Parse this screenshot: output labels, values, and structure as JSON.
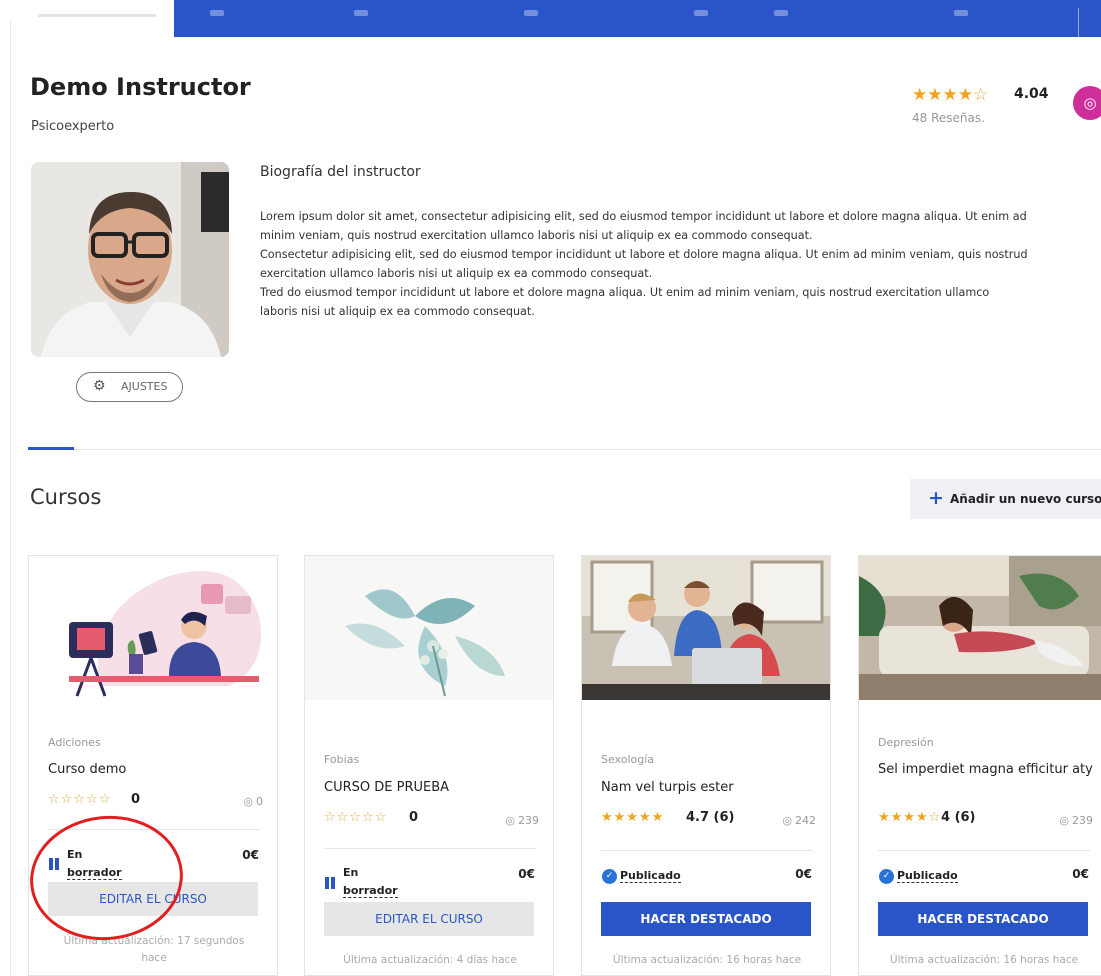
{
  "instructor": {
    "name": "Demo Instructor",
    "role": "Psicoexperto",
    "rating": "4.04",
    "reviews": "48 Reseñas.",
    "settings_label": "AJUSTES",
    "social_icon": "instagram-icon"
  },
  "bio": {
    "title": "Biografía del instructor",
    "lines": [
      "Lorem ipsum dolor sit amet, consectetur adipisicing elit, sed do eiusmod tempor incididunt ut labore et dolore magna aliqua. Ut enim ad",
      "minim veniam, quis nostrud exercitation ullamco laboris nisi ut aliquip ex ea commodo consequat.",
      "Consectetur adipisicing elit, sed do eiusmod tempor incididunt ut labore et dolore magna aliqua. Ut enim ad minim veniam, quis nostrud",
      "exercitation ullamco laboris nisi ut aliquip ex ea commodo consequat.",
      "Tred do eiusmod tempor incididunt ut labore et dolore magna aliqua. Ut enim ad minim veniam, quis nostrud exercitation ullamco",
      "laboris nisi ut aliquip ex ea commodo consequat."
    ]
  },
  "courses": {
    "title": "Cursos",
    "add_label": "Añadir un nuevo curso",
    "items": [
      {
        "category": "Adiciones",
        "title": "Curso demo",
        "stars": 0,
        "score": "0",
        "views": "0",
        "status_l1": "En",
        "status_l2": "borrador",
        "price": "0€",
        "action": "EDITAR EL CURSO",
        "updated_l1": "Última actualización: 17 segundos",
        "updated_l2": "hace"
      },
      {
        "category": "Fobias",
        "title": "CURSO DE PRUEBA",
        "stars": 0,
        "score": "0",
        "views": "239",
        "status_l1": "En",
        "status_l2": "borrador",
        "price": "0€",
        "action": "EDITAR EL CURSO",
        "updated_l1": "Última actualización: 4 días hace"
      },
      {
        "category": "Sexología",
        "title": "Nam vel turpis ester",
        "stars": 4.7,
        "score": "4.7 (6)",
        "views": "242",
        "status": "Publicado",
        "price": "0€",
        "action": "HACER DESTACADO",
        "updated_l1": "Última actualización: 16 horas hace"
      },
      {
        "category": "Depresión",
        "title": "Sel imperdiet magna efficitur aty",
        "stars": 4,
        "score": "4 (6)",
        "views": "239",
        "status": "Publicado",
        "price": "0€",
        "action": "HACER DESTACADO",
        "updated_l1": "Última actualización: 16 horas hace"
      }
    ]
  },
  "colors": {
    "primary": "#2a55c9",
    "star": "#f0a320",
    "instagram": "#cf2e9a",
    "annotation": "#e02020"
  }
}
